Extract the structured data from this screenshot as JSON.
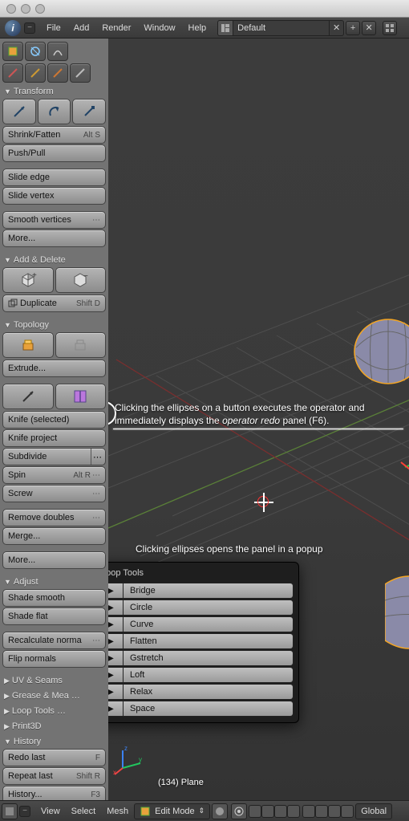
{
  "menubar": {
    "items": [
      "File",
      "Add",
      "Render",
      "Window",
      "Help"
    ],
    "layout_value": "Default"
  },
  "panels": {
    "transform": {
      "title": "Transform",
      "shrink": "Shrink/Fatten",
      "shrink_kbd": "Alt S",
      "pushpull": "Push/Pull",
      "slide_edge": "Slide edge",
      "slide_vertex": "Slide vertex",
      "smooth": "Smooth vertices",
      "more": "More..."
    },
    "add_delete": {
      "title": "Add & Delete",
      "duplicate": "Duplicate",
      "duplicate_kbd": "Shift D"
    },
    "topology": {
      "title": "Topology",
      "extrude": "Extrude...",
      "knife_sel": "Knife (selected)",
      "knife_proj": "Knife project",
      "subdivide": "Subdivide",
      "spin": "Spin",
      "spin_kbd": "Alt R",
      "screw": "Screw",
      "rem_doubles": "Remove doubles",
      "merge": "Merge...",
      "more": "More..."
    },
    "adjust": {
      "title": "Adjust",
      "shade_smooth": "Shade smooth",
      "shade_flat": "Shade flat",
      "recalc": "Recalculate norma",
      "flip": "Flip normals"
    },
    "uv": "UV & Seams",
    "grease": "Grease & Mea …",
    "loop": "Loop Tools        …",
    "print3d": "Print3D",
    "history": {
      "title": "History",
      "redo": "Redo last",
      "redo_kbd": "F",
      "repeat": "Repeat last",
      "repeat_kbd": "Shift R",
      "hist": "History...",
      "hist_kbd": "F3"
    }
  },
  "annot1_line1": "Clicking the ellipses on a button executes the operator and",
  "annot1_line2a": "immediately displays the ",
  "annot1_line2b": "operator redo",
  "annot1_line2c": " panel (F6).",
  "annot2": "Clicking ellipses opens the panel in a popup",
  "popup": {
    "title": "Loop Tools",
    "items": [
      "Bridge",
      "Circle",
      "Curve",
      "Flatten",
      "Gstretch",
      "Loft",
      "Relax",
      "Space"
    ]
  },
  "object_label": "(134) Plane",
  "footer": {
    "view": "View",
    "select": "Select",
    "mesh": "Mesh",
    "mode": "Edit Mode",
    "orient": "Global"
  }
}
